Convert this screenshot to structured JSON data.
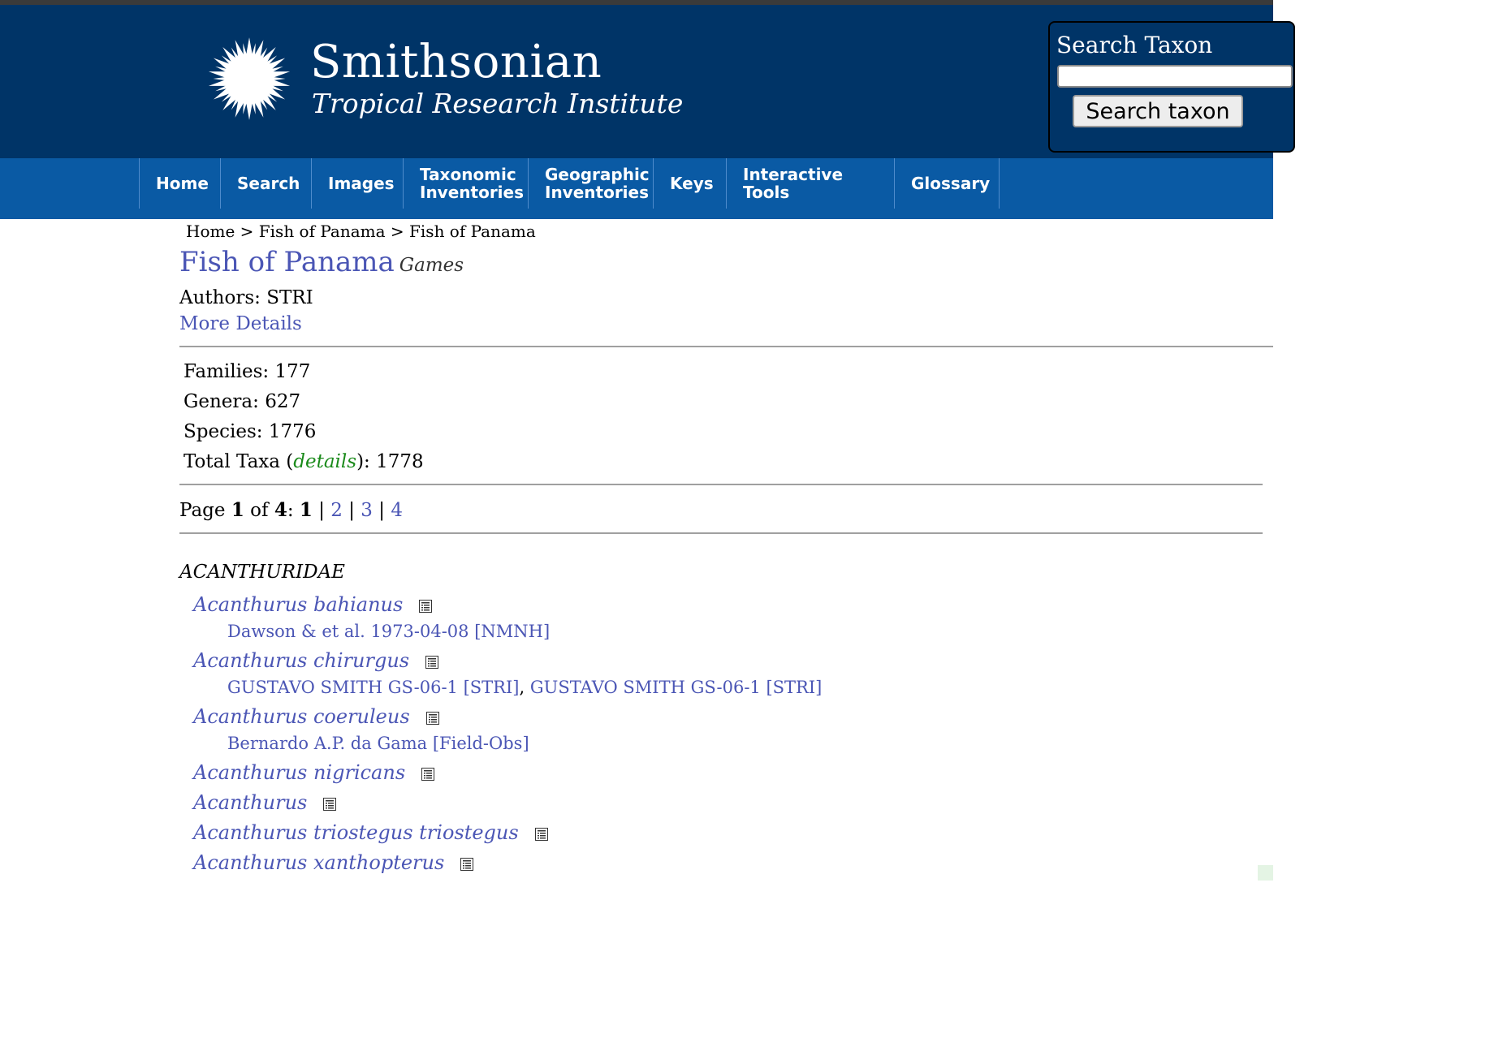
{
  "brand": {
    "title": "Smithsonian",
    "subtitle": "Tropical Research Institute",
    "logo_icon": "sun-logo-icon"
  },
  "search": {
    "title": "Search Taxon",
    "input_value": "",
    "button_label": "Search taxon"
  },
  "nav": {
    "items": [
      {
        "label": "Home"
      },
      {
        "label": "Search"
      },
      {
        "label": "Images"
      },
      {
        "label": "Taxonomic Inventories"
      },
      {
        "label": "Geographic Inventories"
      },
      {
        "label": "Keys"
      },
      {
        "label": "Interactive Tools"
      },
      {
        "label": "Glossary"
      }
    ]
  },
  "breadcrumb": {
    "items": [
      "Home",
      "Fish of Panama",
      "Fish of Panama"
    ],
    "separator": ">"
  },
  "page": {
    "title": "Fish of Panama",
    "games_label": "Games",
    "authors_label": "Authors:",
    "authors_value": "STRI",
    "more_details": "More Details"
  },
  "stats": {
    "families_label": "Families:",
    "families_value": "177",
    "genera_label": "Genera:",
    "genera_value": "627",
    "species_label": "Species:",
    "species_value": "1776",
    "total_label": "Total Taxa (",
    "total_link": "details",
    "total_close": "):",
    "total_value": "1778"
  },
  "pager": {
    "prefix": "Page ",
    "current": "1",
    "of_text": " of ",
    "total": "4",
    "colon": ": ",
    "current_page": "1",
    "pages": [
      "2",
      "3",
      "4"
    ],
    "separator": "|"
  },
  "family": "ACANTHURIDAE",
  "taxa": [
    {
      "name": "Acanthurus bahianus",
      "icon": "checklist-icon"
    },
    {
      "name": "Acanthurus chirurgus",
      "icon": "checklist-icon"
    },
    {
      "name": "Acanthurus coeruleus",
      "icon": "checklist-icon"
    },
    {
      "name": "Acanthurus nigricans",
      "icon": "checklist-icon"
    },
    {
      "name": "Acanthurus",
      "icon": "checklist-icon"
    },
    {
      "name": "Acanthurus triostegus triostegus",
      "icon": "checklist-icon"
    },
    {
      "name": "Acanthurus xanthopterus",
      "icon": "checklist-icon"
    }
  ],
  "records": {
    "bahianus": "Dawson & et al. 1973-04-08 [NMNH]",
    "chirurgus_1": "GUSTAVO SMITH GS-06-1 [STRI]",
    "chirurgus_sep": ",",
    "chirurgus_2": "GUSTAVO SMITH GS-06-1 [STRI]",
    "coeruleus": "Bernardo A.P. da Gama [Field-Obs]"
  },
  "colors": {
    "header_bg": "#003467",
    "nav_bg": "#0a5aa4",
    "link": "#4b56b5",
    "details_link": "#1a8a1a"
  }
}
